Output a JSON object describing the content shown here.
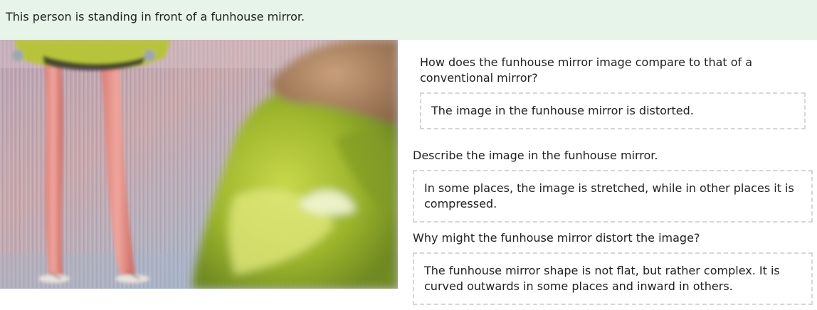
{
  "banner": {
    "text": "This person is standing in front of a funhouse mirror."
  },
  "image": {
    "description": "person-in-funhouse-mirror-photo"
  },
  "questions": [
    {
      "prompt": "How does the funhouse mirror image compare to that of a conventional mirror?",
      "answer": "The image in the funhouse mirror is distorted."
    },
    {
      "prompt": "Describe the image in the funhouse mirror.",
      "answer": "In some places, the image is stretched, while in other places it is compressed."
    },
    {
      "prompt": "Why might the funhouse mirror distort the image?",
      "answer": "The funhouse mirror shape is not flat, but rather complex. It is curved outwards in some places and inward in others."
    }
  ]
}
